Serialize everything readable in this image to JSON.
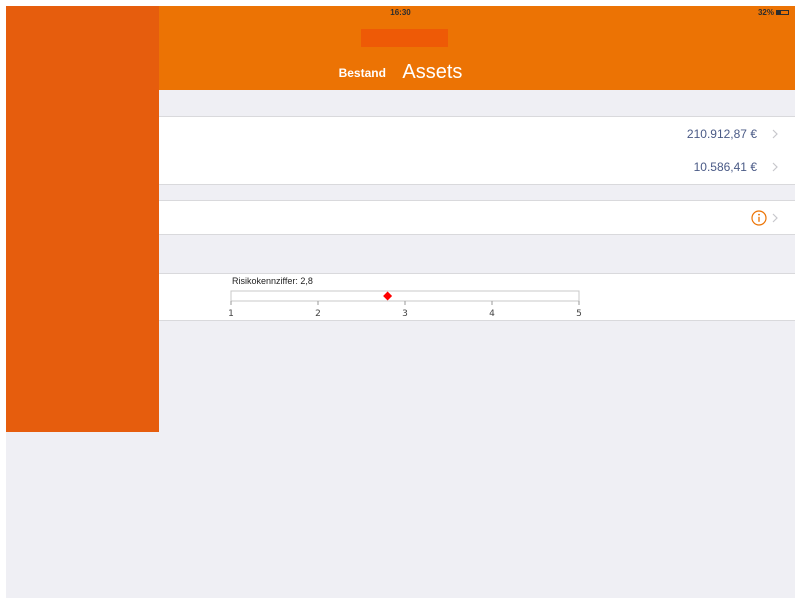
{
  "status_bar": {
    "time": "16:30",
    "battery": "32%"
  },
  "nav": {
    "back_label": "Bestand",
    "title": "Assets"
  },
  "rows": [
    {
      "value": "210.912,87 €"
    },
    {
      "value": "10.586,41 €"
    }
  ],
  "risk": {
    "label": "Risikokennziffer: 2,8",
    "value": 2.8,
    "min": 1,
    "max": 5,
    "ticks": [
      "1",
      "2",
      "3",
      "4",
      "5"
    ],
    "marker_color": "#ff0000"
  },
  "colors": {
    "header": "#ec7304",
    "sidebar": "#e65d0d",
    "background": "#efeff4",
    "value_text": "#4a5a86",
    "info_icon": "#ec7304"
  }
}
